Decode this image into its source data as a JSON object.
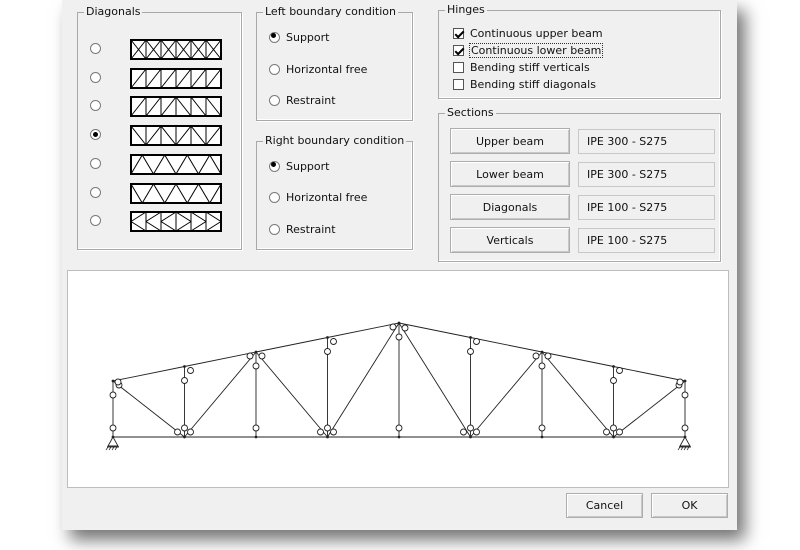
{
  "diagonals": {
    "title": "Diagonals",
    "options": [
      {
        "type": "x-all",
        "selected": false
      },
      {
        "type": "single-diagonals",
        "selected": false
      },
      {
        "type": "n-pattern",
        "selected": false
      },
      {
        "type": "v-alternating",
        "selected": true
      },
      {
        "type": "warren",
        "selected": false
      },
      {
        "type": "warren-inverted",
        "selected": false
      },
      {
        "type": "k-pattern",
        "selected": false
      }
    ]
  },
  "left_boundary": {
    "title": "Left boundary condition",
    "options": [
      {
        "label": "Support",
        "selected": true
      },
      {
        "label": "Horizontal free",
        "selected": false
      },
      {
        "label": "Restraint",
        "selected": false
      }
    ]
  },
  "right_boundary": {
    "title": "Right boundary condition",
    "options": [
      {
        "label": "Support",
        "selected": true
      },
      {
        "label": "Horizontal free",
        "selected": false
      },
      {
        "label": "Restraint",
        "selected": false
      }
    ]
  },
  "hinges": {
    "title": "Hinges",
    "items": [
      {
        "label": "Continuous upper beam",
        "checked": true
      },
      {
        "label": "Continuous lower beam",
        "checked": true
      },
      {
        "label": "Bending stiff verticals",
        "checked": false
      },
      {
        "label": "Bending stiff diagonals",
        "checked": false
      }
    ]
  },
  "sections": {
    "title": "Sections",
    "rows": [
      {
        "button": "Upper beam",
        "value": "IPE 300 - S275"
      },
      {
        "button": "Lower beam",
        "value": "IPE 300 - S275"
      },
      {
        "button": "Diagonals",
        "value": "IPE 100 - S275"
      },
      {
        "button": "Verticals",
        "value": "IPE 100 - S275"
      }
    ]
  },
  "buttons": {
    "cancel": "Cancel",
    "ok": "OK"
  },
  "preview": {
    "panels": 8,
    "diagonal_pattern": "v-alternating",
    "left_support": "pin",
    "right_support": "pin"
  }
}
